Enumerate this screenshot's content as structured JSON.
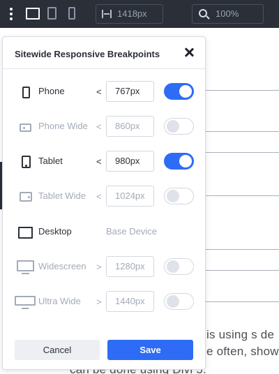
{
  "toolbar": {
    "menu_icon": "kebab-menu-icon",
    "views": [
      "desktop-icon",
      "tablet-icon",
      "phone-icon"
    ],
    "width_value": "1418px",
    "zoom_value": "100%"
  },
  "background": {
    "text_line_1": "is using s de",
    "text_line_2": "e often, show",
    "text_line_3": "can be done using Divi 5."
  },
  "modal": {
    "title": "Sitewide Responsive Breakpoints",
    "rows": [
      {
        "label": "Phone",
        "comparator": "<",
        "value": "767px",
        "enabled": true,
        "icon": "phone-icon"
      },
      {
        "label": "Phone Wide",
        "comparator": "<",
        "value": "860px",
        "enabled": false,
        "icon": "phone-wide-icon"
      },
      {
        "label": "Tablet",
        "comparator": "<",
        "value": "980px",
        "enabled": true,
        "icon": "tablet-icon"
      },
      {
        "label": "Tablet Wide",
        "comparator": "<",
        "value": "1024px",
        "enabled": false,
        "icon": "tablet-wide-icon"
      },
      {
        "label": "Desktop",
        "base_text": "Base Device",
        "icon": "desktop-icon"
      },
      {
        "label": "Widescreen",
        "comparator": ">",
        "value": "1280px",
        "enabled": false,
        "icon": "widescreen-icon"
      },
      {
        "label": "Ultra Wide",
        "comparator": ">",
        "value": "1440px",
        "enabled": false,
        "icon": "ultra-wide-icon"
      }
    ],
    "cancel_label": "Cancel",
    "save_label": "Save"
  },
  "colors": {
    "toolbar_bg": "#2a2f38",
    "accent": "#2e6cf6",
    "muted": "#a3aab8"
  }
}
